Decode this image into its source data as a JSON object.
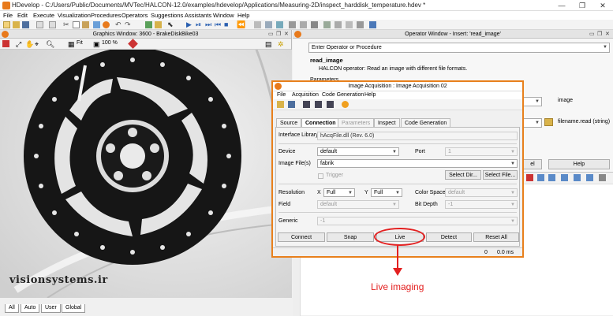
{
  "app_title": "HDevelop - C:/Users/Public/Documents/MVTec/HALCON-12.0/examples/hdevelop/Applications/Measuring-2D/inspect_harddisk_temperature.hdev *",
  "window_controls": [
    "—",
    "❐",
    "✕"
  ],
  "menu": [
    "File",
    "Edit",
    "Execute",
    "Visualization",
    "Procedures",
    "Operators",
    "Suggestions",
    "Assistants",
    "Window",
    "Help"
  ],
  "graphics": {
    "title": "Graphics Window: 3600 - BrakeDiskBike03",
    "fit_label": "Fit",
    "zoom_label": "100 %",
    "watermark": "visionsystems.ir",
    "bottom_tabs": [
      "All",
      "Auto",
      "User",
      "Global"
    ]
  },
  "operator": {
    "title": "Operator Window - Insert: 'read_image'",
    "input_placeholder": "Enter Operator or Procedure",
    "op_name": "read_image",
    "op_desc": "HALCON operator:  Read an image with different file formats.",
    "params_heading": "Parameters",
    "param1_label": "image",
    "param2_label": "filename.read (string)",
    "cancel_fragment": "el",
    "help_button": "Help"
  },
  "dialog": {
    "title": "Image Acquisition : Image Acquisition 02",
    "menu": [
      "File",
      "Acquisition",
      "Code Generation",
      "Help"
    ],
    "tabs": [
      "Source",
      "Connection",
      "Parameters",
      "Inspect",
      "Code Generation"
    ],
    "interface_label": "Interface Library",
    "interface_value": "hAcqFile.dll (Rev. 6.0)",
    "device_label": "Device",
    "device_value": "default",
    "port_label": "Port",
    "port_value": "1",
    "imagefile_label": "Image File(s)",
    "imagefile_value": "fabrik",
    "select_dir": "Select Dir...",
    "select_file": "Select File...",
    "trigger_label": "Trigger",
    "resolution_label": "Resolution",
    "x_label": "X",
    "x_value": "Full",
    "y_label": "Y",
    "y_value": "Full",
    "colorspace_label": "Color Space",
    "colorspace_value": "default",
    "field_label": "Field",
    "field_value": "default",
    "bitdepth_label": "Bit Depth",
    "bitdepth_value": "-1",
    "generic_label": "Generic",
    "generic_value": "-1",
    "buttons": [
      "Connect",
      "Snap",
      "Live",
      "Detect",
      "Reset All"
    ],
    "status_count": "0",
    "status_time": "0.0 ms"
  },
  "annotation": "Live imaging",
  "colors": {
    "accent": "#e8801c",
    "annotation": "#e32020"
  }
}
